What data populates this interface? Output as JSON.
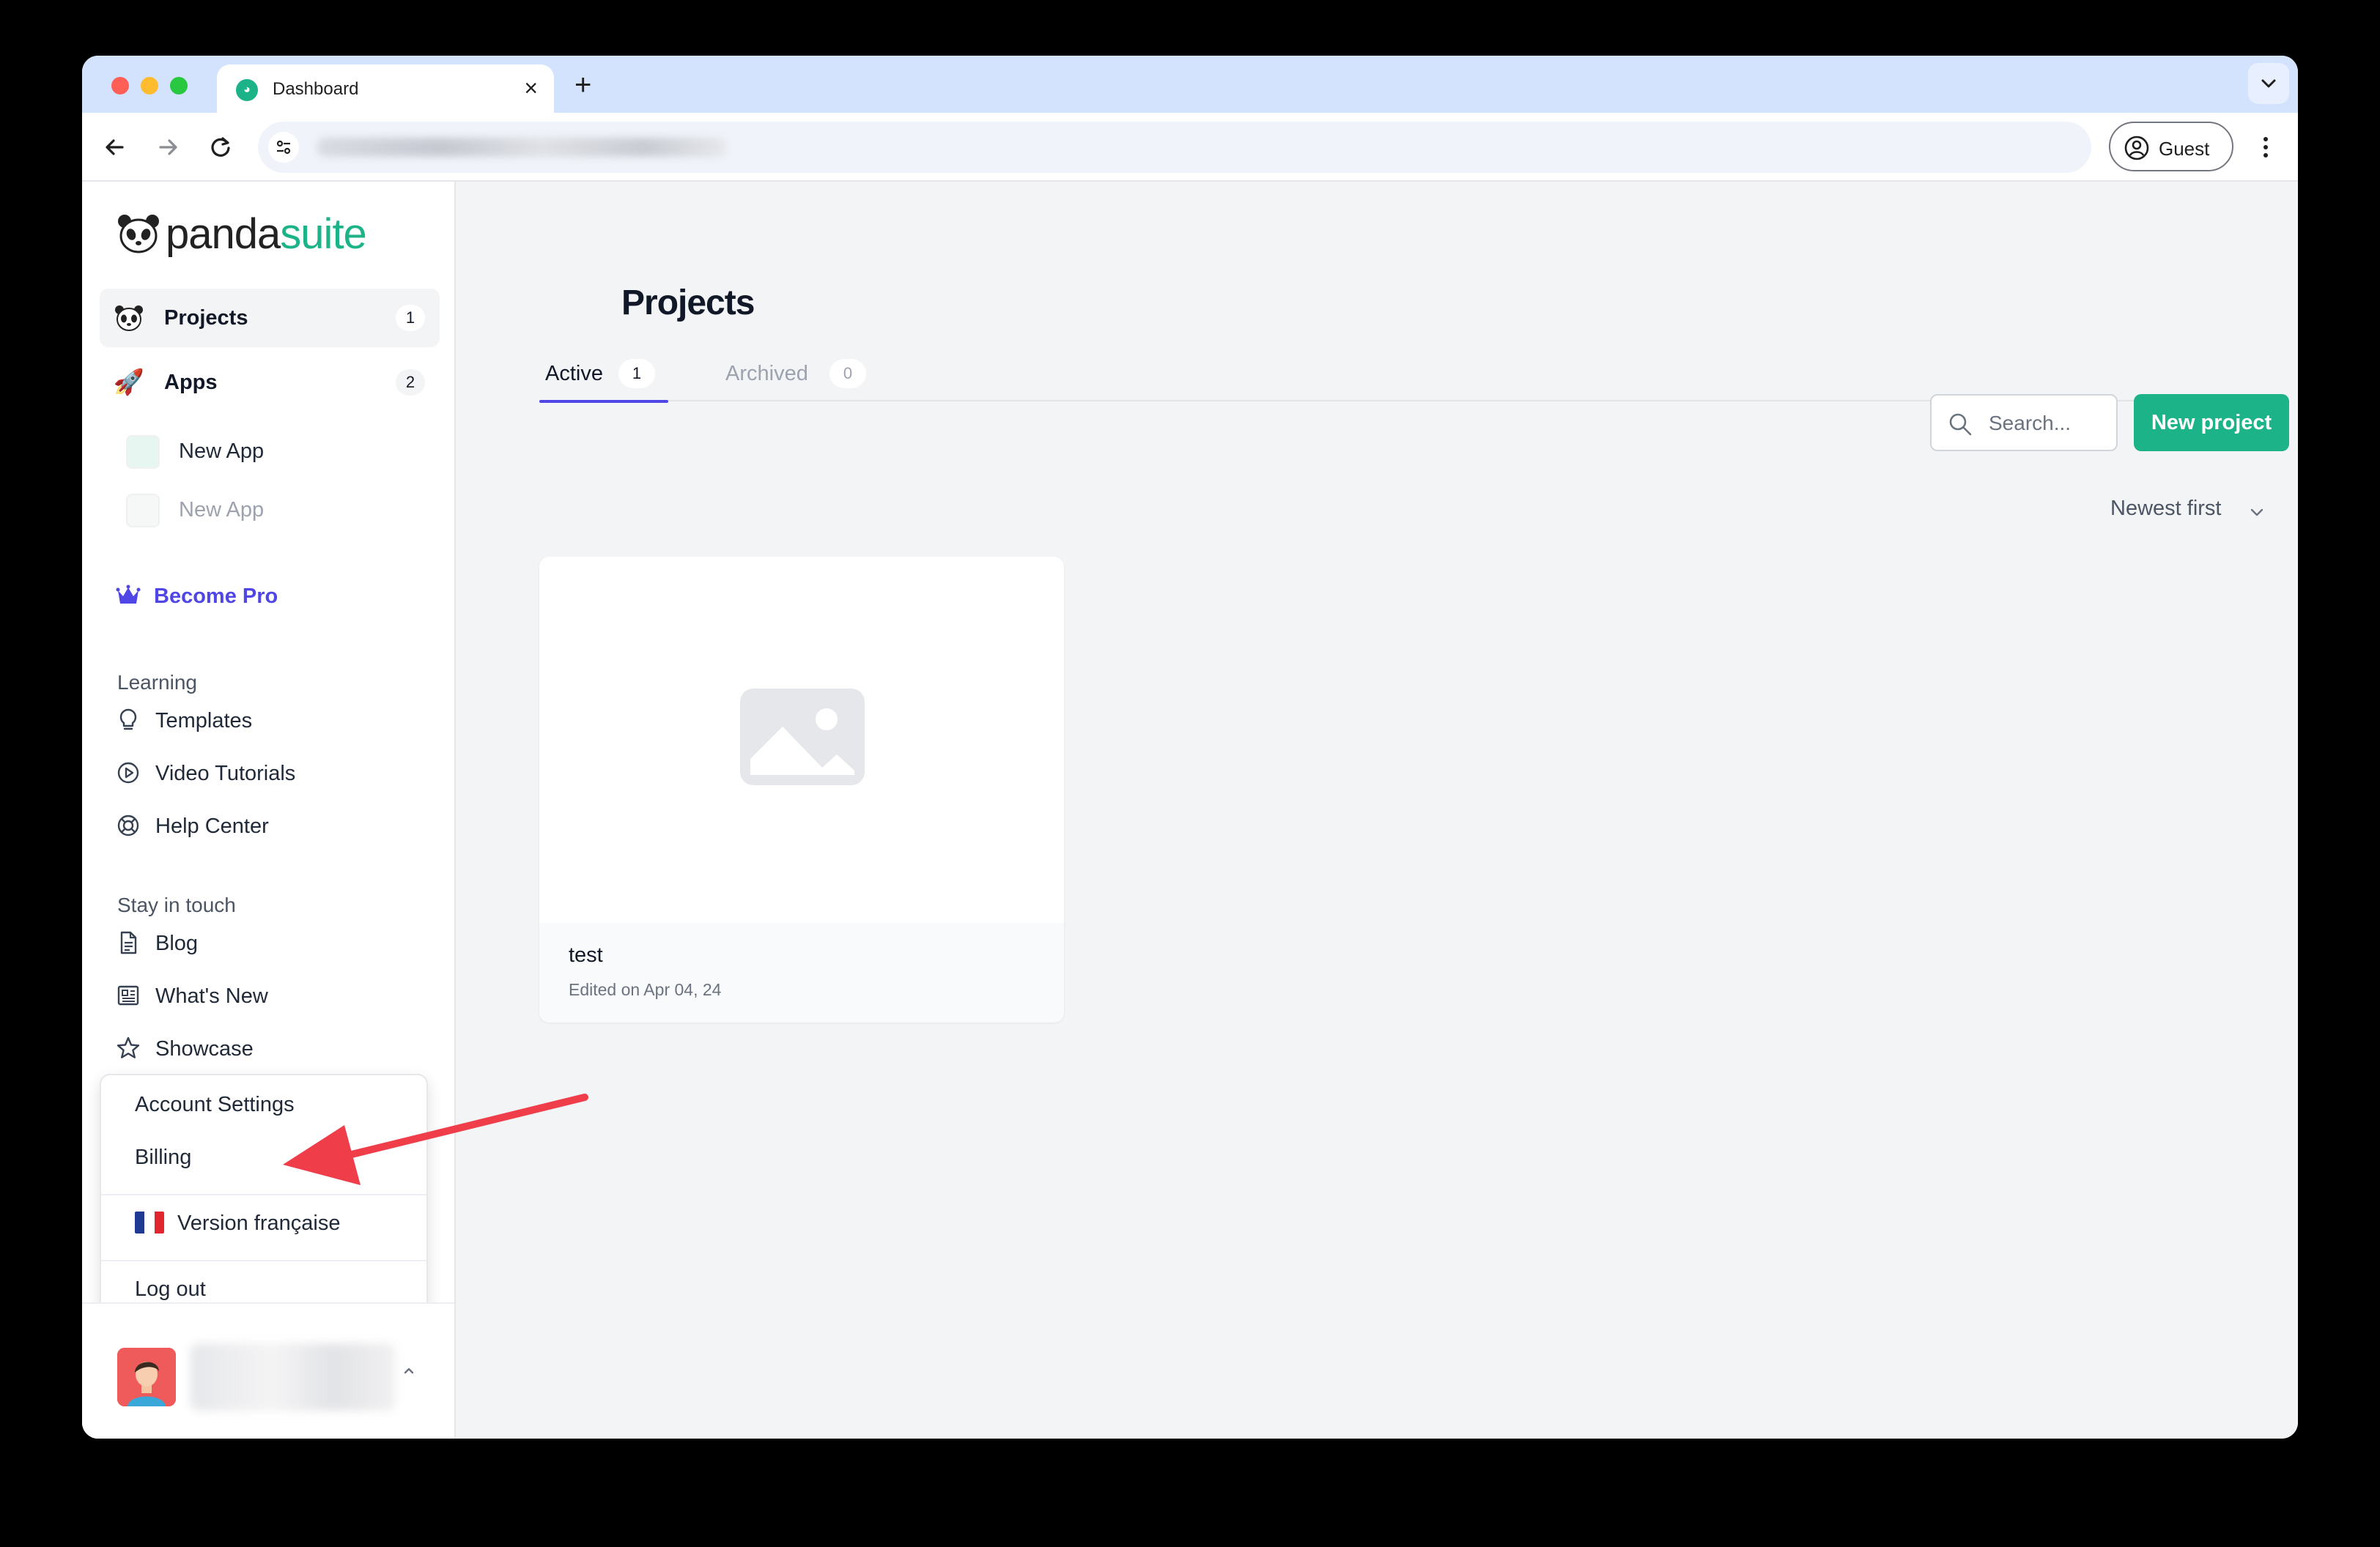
{
  "browser": {
    "tab_title": "Dashboard",
    "tab_close": "×",
    "new_tab": "+",
    "profile_label": "Guest"
  },
  "sidebar": {
    "logo": {
      "part1": "panda",
      "part2": "suite"
    },
    "nav": [
      {
        "label": "Projects",
        "count": "1",
        "icon": "panda-icon"
      },
      {
        "label": "Apps",
        "count": "2",
        "icon": "rocket-icon"
      }
    ],
    "apps": [
      {
        "label": "New App"
      },
      {
        "label": "New App"
      }
    ],
    "become_pro": "Become Pro",
    "learning": {
      "heading": "Learning",
      "items": [
        {
          "label": "Templates",
          "icon": "lightbulb-icon"
        },
        {
          "label": "Video Tutorials",
          "icon": "play-circle-icon"
        },
        {
          "label": "Help Center",
          "icon": "lifebuoy-icon"
        }
      ]
    },
    "stay_in_touch": {
      "heading": "Stay in touch",
      "items": [
        {
          "label": "Blog",
          "icon": "document-icon"
        },
        {
          "label": "What's New",
          "icon": "newspaper-icon"
        },
        {
          "label": "Showcase",
          "icon": "star-icon"
        }
      ]
    },
    "account_menu": {
      "items": [
        {
          "label": "Account Settings"
        },
        {
          "label": "Billing"
        },
        {
          "label": "Version française"
        },
        {
          "label": "Log out"
        }
      ]
    }
  },
  "main": {
    "title": "Projects",
    "tabs": [
      {
        "label": "Active",
        "count": "1"
      },
      {
        "label": "Archived",
        "count": "0"
      }
    ],
    "search_placeholder": "Search...",
    "new_project": "New project",
    "sort": "Newest first",
    "projects": [
      {
        "name": "test",
        "edited": "Edited on Apr 04, 24"
      }
    ]
  },
  "colors": {
    "brand": "#1db388",
    "accent": "#4f46e5",
    "arrow": "#ef3e4a"
  }
}
